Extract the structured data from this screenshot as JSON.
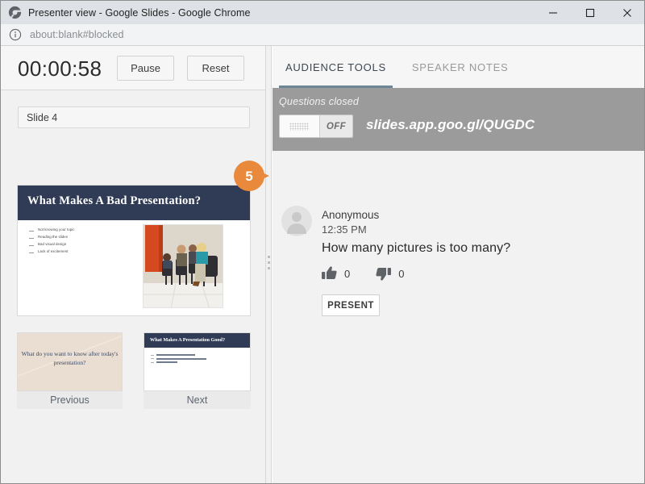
{
  "window": {
    "title": "Presenter view - Google Slides - Google Chrome",
    "app_icon": "chrome-globe-icon",
    "minimize_label": "minimize-icon",
    "maximize_label": "maximize-icon",
    "close_label": "close-icon"
  },
  "urlbar": {
    "info_icon": "info-circle-icon",
    "url": "about:blank#blocked"
  },
  "presenter": {
    "timer": "00:00:58",
    "pause_label": "Pause",
    "reset_label": "Reset",
    "slide_selector": "Slide 4",
    "current_slide": {
      "title": "What Makes A Bad Presentation?",
      "bullets": [
        "Not knowing your topic",
        "Reading the slides",
        "Bad visual design",
        "Lack of excitement"
      ],
      "image_alt": "bored-audience-photo"
    },
    "previous": {
      "label": "Previous",
      "text": "What do you want to know after today's presentation?"
    },
    "next": {
      "label": "Next",
      "title": "What Makes A Presentation Good?"
    },
    "splitter": "panel-resize-handle"
  },
  "audience": {
    "tabs": [
      {
        "label": "AUDIENCE TOOLS",
        "active": true
      },
      {
        "label": "SPEAKER NOTES",
        "active": false
      }
    ],
    "questions_status": "Questions closed",
    "toggle_state": "OFF",
    "share_url": "slides.app.goo.gl/QUGDC",
    "question": {
      "author": "Anonymous",
      "time": "12:35 PM",
      "text": "How many pictures is too many?",
      "thumbs_up_icon": "thumbs-up-icon",
      "thumbs_up": "0",
      "thumbs_down_icon": "thumbs-down-icon",
      "thumbs_down": "0",
      "present_label": "PRESENT"
    }
  },
  "callout": {
    "number": "5"
  },
  "colors": {
    "accent_orange": "#e8893c",
    "slide_navy": "#303c55",
    "tab_underline": "#6d8695",
    "gray_bar": "#9b9b9b"
  }
}
